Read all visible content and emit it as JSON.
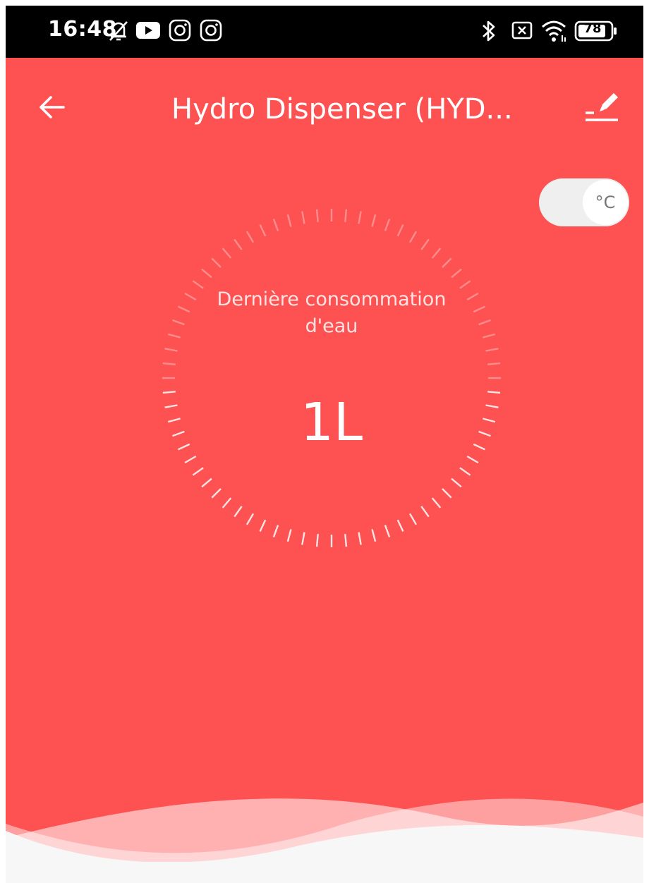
{
  "status_bar": {
    "time": "16:48",
    "battery": "78",
    "icons": [
      "bell-off-icon",
      "youtube-icon",
      "instagram-icon",
      "instagram-icon",
      "bluetooth-icon",
      "sim-off-icon",
      "wifi-icon",
      "battery-icon"
    ]
  },
  "header": {
    "title": "Hydro Dispenser (HYD..."
  },
  "unit_toggle": {
    "label": "°C"
  },
  "consumption": {
    "label": "Dernière consommation d'eau",
    "value": "1L"
  },
  "colors": {
    "background": "#fe5252",
    "accent": "#ffffff"
  }
}
